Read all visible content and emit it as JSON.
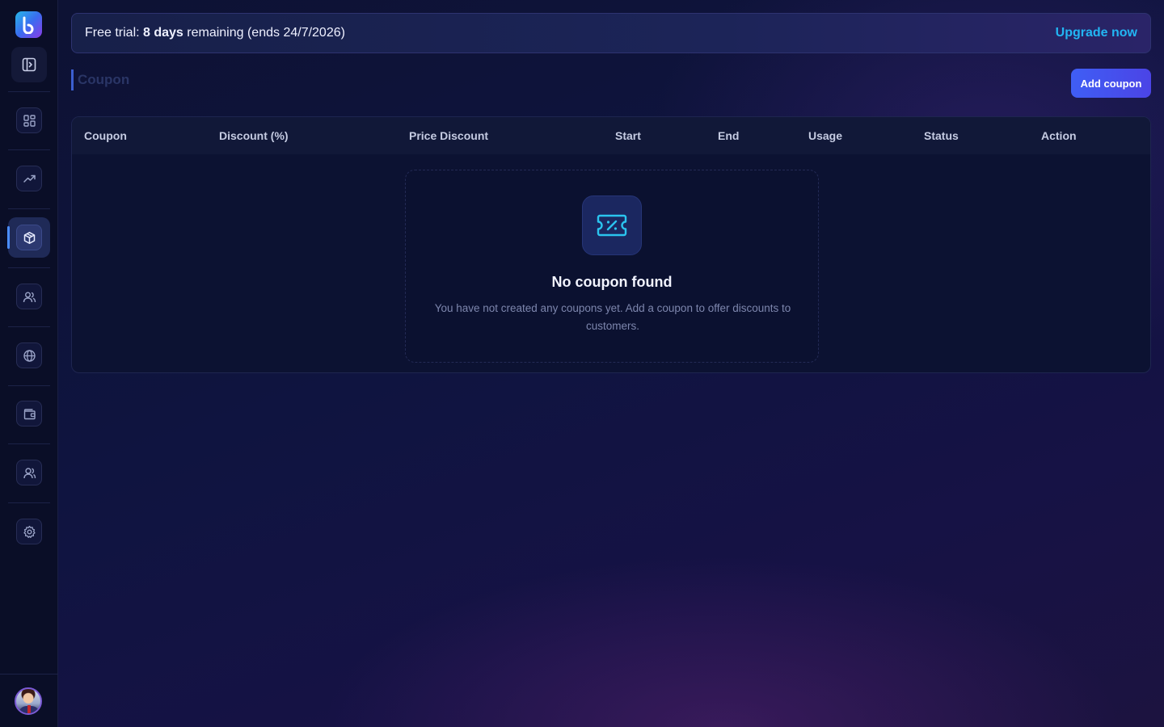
{
  "banner": {
    "prefix": "Free trial: ",
    "days": "8 days",
    "suffix": " remaining (ends 24/7/2026)",
    "upgrade_label": "Upgrade now"
  },
  "page": {
    "title": "Coupon",
    "add_button_label": "Add coupon"
  },
  "sidebar": {
    "items": [
      {
        "name": "dashboard",
        "icon": "grid-icon",
        "active": false
      },
      {
        "name": "analytics",
        "icon": "trending-up-icon",
        "active": false
      },
      {
        "name": "products",
        "icon": "package-icon",
        "active": true
      },
      {
        "name": "customers",
        "icon": "users-icon",
        "active": false
      },
      {
        "name": "website",
        "icon": "globe-icon",
        "active": false
      },
      {
        "name": "wallet",
        "icon": "wallet-icon",
        "active": false
      },
      {
        "name": "team",
        "icon": "team-icon",
        "active": false
      },
      {
        "name": "settings",
        "icon": "gear-icon",
        "active": false
      }
    ]
  },
  "table": {
    "columns": [
      "Coupon",
      "Discount (%)",
      "Price Discount",
      "Start",
      "End",
      "Usage",
      "Status",
      "Action"
    ],
    "rows": []
  },
  "empty_state": {
    "icon": "ticket-percent-icon",
    "title": "No coupon found",
    "description": "You have not created any coupons yet. Add a coupon to offer discounts to customers."
  },
  "colors": {
    "accent": "#22b6f3",
    "primary_button": "#4552ee",
    "sidebar_bg": "#0a0e27"
  }
}
